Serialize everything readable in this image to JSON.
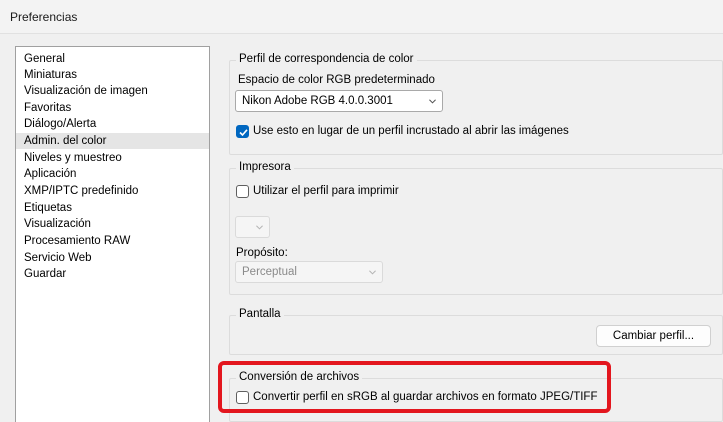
{
  "window": {
    "title": "Preferencias"
  },
  "sidebar": {
    "items": [
      {
        "label": "General"
      },
      {
        "label": "Miniaturas"
      },
      {
        "label": "Visualización de imagen"
      },
      {
        "label": "Favoritas"
      },
      {
        "label": "Diálogo/Alerta"
      },
      {
        "label": "Admin. del color",
        "selected": true
      },
      {
        "label": "Niveles y muestreo"
      },
      {
        "label": "Aplicación"
      },
      {
        "label": "XMP/IPTC predefinido"
      },
      {
        "label": "Etiquetas"
      },
      {
        "label": "Visualización"
      },
      {
        "label": "Procesamiento RAW"
      },
      {
        "label": "Servicio Web"
      },
      {
        "label": "Guardar"
      }
    ]
  },
  "color_profile": {
    "legend": "Perfil de correspondencia de color",
    "rgb_label": "Espacio de color RGB predeterminado",
    "rgb_value": "Nikon Adobe RGB 4.0.0.3001",
    "use_instead_label": "Use esto en lugar de un perfil incrustado al abrir las imágenes",
    "use_instead_checked": true
  },
  "printer": {
    "legend": "Impresora",
    "use_profile_label": "Utilizar el perfil para imprimir",
    "use_profile_checked": false,
    "profile_value": "",
    "purpose_label": "Propósito:",
    "purpose_value": "Perceptual"
  },
  "display": {
    "legend": "Pantalla",
    "change_button": "Cambiar perfil..."
  },
  "file_conversion": {
    "legend": "Conversión de archivos",
    "convert_label": "Convertir perfil en sRGB al guardar archivos en formato JPEG/TIFF",
    "convert_checked": false
  },
  "colors": {
    "accent": "#0067c0",
    "highlight": "#e3161e"
  }
}
